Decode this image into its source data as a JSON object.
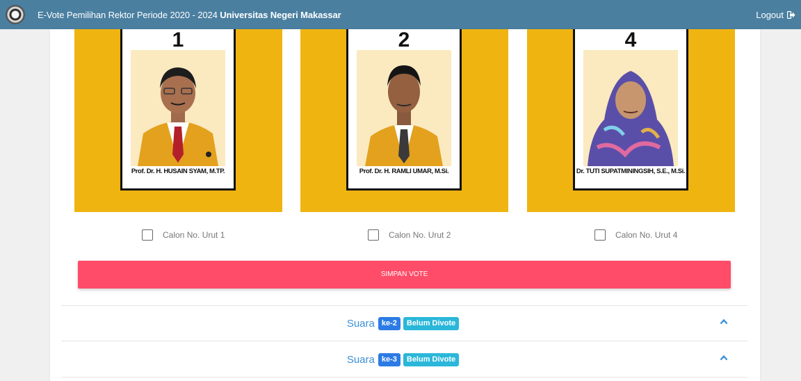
{
  "header": {
    "title_prefix": "E-Vote Pemilihan Rektor Periode 2020 - 2024 ",
    "title_bold": "Universitas Negeri Makassar",
    "logout_label": "Logout",
    "logo_icon": "university-seal-icon",
    "logout_icon": "sign-out-icon",
    "background": "#4a7fa0"
  },
  "candidates": [
    {
      "number": "1",
      "name": "Prof. Dr. H. HUSAIN SYAM, M.TP.",
      "checkbox_label": "Calon No. Urut 1",
      "checked": false,
      "suit": "#e3a11d",
      "tie": "#b3202a",
      "headcover": "none"
    },
    {
      "number": "2",
      "name": "Prof. Dr. H. RAMLI UMAR, M.Si.",
      "checkbox_label": "Calon No. Urut 2",
      "checked": false,
      "suit": "#e3a11d",
      "tie": "#3a3a3a",
      "headcover": "none"
    },
    {
      "number": "4",
      "name": "Dr. TUTI SUPATMININGSIH, S.E., M.Si.",
      "checkbox_label": "Calon No. Urut 4",
      "checked": false,
      "suit": "#4466c4",
      "tie": "none",
      "headcover": "hijab"
    }
  ],
  "save_button_label": "SIMPAN VOTE",
  "suara_sections": [
    {
      "label": "Suara",
      "badge_ke": "ke-2",
      "badge_status": "Belum Divote",
      "icon": "chevron-up-icon"
    },
    {
      "label": "Suara",
      "badge_ke": "ke-3",
      "badge_status": "Belum Divote",
      "icon": "chevron-up-icon"
    }
  ],
  "colors": {
    "card_background": "#f0b411",
    "save_button": "#ff4c68",
    "link_blue": "#3a8fd6",
    "badge_primary": "#2c7be5",
    "badge_info": "#2ab7d9"
  }
}
